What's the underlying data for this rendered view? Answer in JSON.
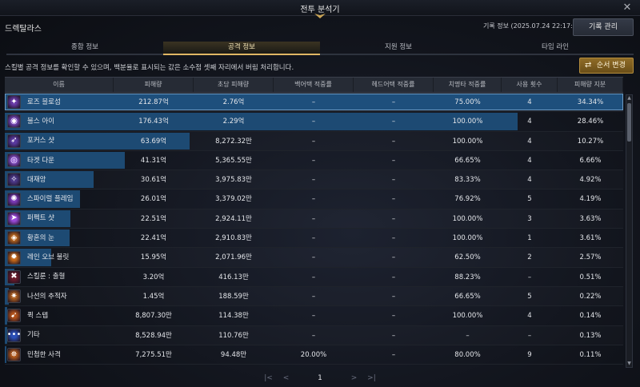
{
  "window": {
    "title": "전투 분석기",
    "close_glyph": "✕"
  },
  "header": {
    "character": "드렉탈라스",
    "record_info": "기록 정보 (2025.07.24 22:17:08)",
    "record_btn": "기록 관리"
  },
  "tabs": [
    {
      "label": "종합 정보",
      "active": false
    },
    {
      "label": "공격 정보",
      "active": true
    },
    {
      "label": "지원 정보",
      "active": false
    },
    {
      "label": "타임 라인",
      "active": false
    }
  ],
  "notice": "스킬별 공격 정보를 확인할 수 있으며, 백분율로 표시되는 값은 소수점 셋째 자리에서 버림 처리합니다.",
  "order_btn": {
    "label": "순서 변경",
    "icon": "swap-icon"
  },
  "columns": [
    "이름",
    "피해량",
    "초당 피해량",
    "백어택 적중률",
    "헤드어택 적중률",
    "치명타 적중률",
    "사용 횟수",
    "피해량 지분"
  ],
  "rows": [
    {
      "name": "로즈 블로섬",
      "damage": "212.87억",
      "dps": "2.76억",
      "back": "–",
      "head": "–",
      "crit": "75.00%",
      "uses": "4",
      "share": "34.34%",
      "ratio": 1.0,
      "icon_color": "#6a3ca8",
      "icon_glyph": "✦"
    },
    {
      "name": "불스 아이",
      "damage": "176.43억",
      "dps": "2.29억",
      "back": "–",
      "head": "–",
      "crit": "100.00%",
      "uses": "4",
      "share": "28.46%",
      "ratio": 0.829,
      "icon_color": "#7d4ac4",
      "icon_glyph": "◉"
    },
    {
      "name": "포커스 샷",
      "damage": "63.69억",
      "dps": "8,272.32만",
      "back": "–",
      "head": "–",
      "crit": "100.00%",
      "uses": "4",
      "share": "10.27%",
      "ratio": 0.299,
      "icon_color": "#5a3aa0",
      "icon_glyph": "➶"
    },
    {
      "name": "타겟 다운",
      "damage": "41.31억",
      "dps": "5,365.55만",
      "back": "–",
      "head": "–",
      "crit": "66.65%",
      "uses": "4",
      "share": "6.66%",
      "ratio": 0.194,
      "icon_color": "#8a50d0",
      "icon_glyph": "◎"
    },
    {
      "name": "대재앙",
      "damage": "30.61억",
      "dps": "3,975.83만",
      "back": "–",
      "head": "–",
      "crit": "83.33%",
      "uses": "4",
      "share": "4.92%",
      "ratio": 0.144,
      "icon_color": "#4b3888",
      "icon_glyph": "✧"
    },
    {
      "name": "스파이럴 플레임",
      "damage": "26.01억",
      "dps": "3,379.02만",
      "back": "–",
      "head": "–",
      "crit": "76.92%",
      "uses": "5",
      "share": "4.19%",
      "ratio": 0.122,
      "icon_color": "#7b3ab8",
      "icon_glyph": "✺"
    },
    {
      "name": "퍼펙트 샷",
      "damage": "22.51억",
      "dps": "2,924.11만",
      "back": "–",
      "head": "–",
      "crit": "100.00%",
      "uses": "3",
      "share": "3.63%",
      "ratio": 0.106,
      "icon_color": "#9a4ad8",
      "icon_glyph": "➤"
    },
    {
      "name": "황혼의 눈",
      "damage": "22.41억",
      "dps": "2,910.83만",
      "back": "–",
      "head": "–",
      "crit": "100.00%",
      "uses": "1",
      "share": "3.61%",
      "ratio": 0.105,
      "icon_color": "#b8661e",
      "icon_glyph": "◈"
    },
    {
      "name": "레인 오브 불릿",
      "damage": "15.95억",
      "dps": "2,071.96만",
      "back": "–",
      "head": "–",
      "crit": "62.50%",
      "uses": "2",
      "share": "2.57%",
      "ratio": 0.075,
      "icon_color": "#c4681a",
      "icon_glyph": "✹"
    },
    {
      "name": "스킬룬 : 출혈",
      "damage": "3.20억",
      "dps": "416.13만",
      "back": "–",
      "head": "–",
      "crit": "88.23%",
      "uses": "–",
      "share": "0.51%",
      "ratio": 0.015,
      "icon_color": "#6a1a2a",
      "icon_glyph": "✖"
    },
    {
      "name": "나선의 추적자",
      "damage": "1.45억",
      "dps": "188.59만",
      "back": "–",
      "head": "–",
      "crit": "66.65%",
      "uses": "5",
      "share": "0.22%",
      "ratio": 0.007,
      "icon_color": "#a85a1c",
      "icon_glyph": "✷"
    },
    {
      "name": "퀵 스텝",
      "damage": "8,807.30만",
      "dps": "114.38만",
      "back": "–",
      "head": "–",
      "crit": "100.00%",
      "uses": "4",
      "share": "0.14%",
      "ratio": 0.004,
      "icon_color": "#b0501a",
      "icon_glyph": "➹"
    },
    {
      "name": "기타",
      "damage": "8,528.94만",
      "dps": "110.76만",
      "back": "–",
      "head": "–",
      "crit": "–",
      "uses": "–",
      "share": "0.13%",
      "ratio": 0.004,
      "icon_color": "#2a4fb8",
      "icon_glyph": "•••"
    },
    {
      "name": "민첩한 사격",
      "damage": "7,275.51만",
      "dps": "94.48만",
      "back": "20.00%",
      "head": "–",
      "crit": "80.00%",
      "uses": "9",
      "share": "0.11%",
      "ratio": 0.003,
      "icon_color": "#b0581a",
      "icon_glyph": "✵"
    }
  ],
  "pager": {
    "first": "|<",
    "prev": "<",
    "page": "1",
    "next": ">",
    "last": ">|"
  }
}
